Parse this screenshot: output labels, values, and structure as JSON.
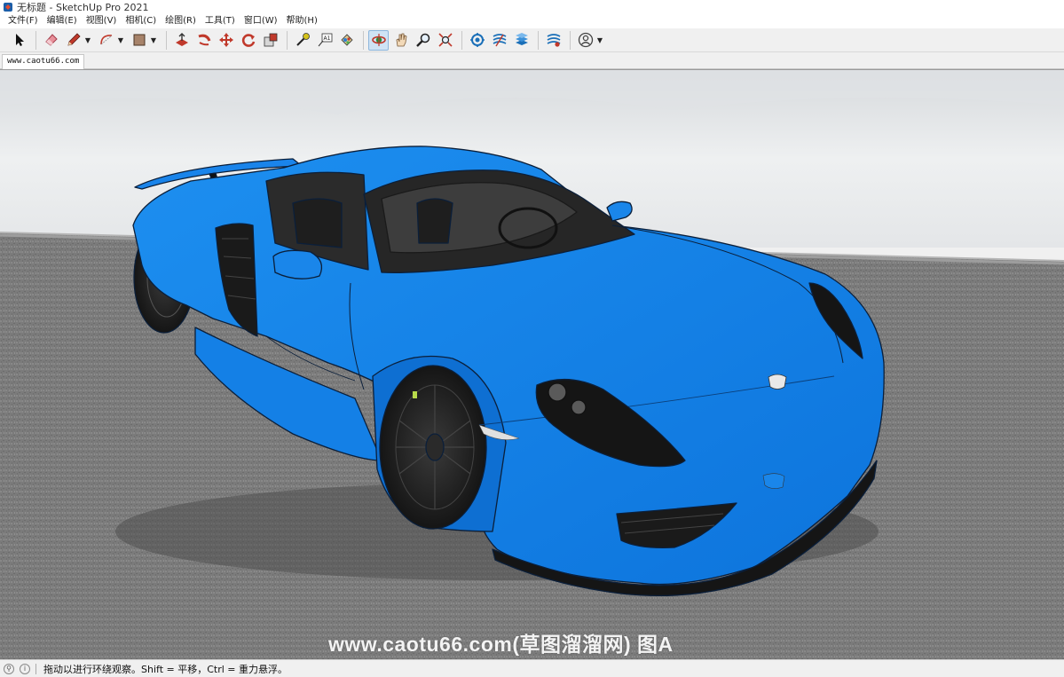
{
  "window": {
    "title": "无标题 - SketchUp Pro 2021"
  },
  "menu": [
    {
      "label": "文件(F)"
    },
    {
      "label": "编辑(E)"
    },
    {
      "label": "视图(V)"
    },
    {
      "label": "相机(C)"
    },
    {
      "label": "绘图(R)"
    },
    {
      "label": "工具(T)"
    },
    {
      "label": "窗口(W)"
    },
    {
      "label": "帮助(H)"
    }
  ],
  "toolbar": {
    "tools": [
      {
        "icon": "select-arrow-icon"
      },
      {
        "icon": "eraser-icon"
      },
      {
        "icon": "pencil-line-icon"
      },
      {
        "icon": "arc-icon"
      },
      {
        "icon": "rectangle-shape-icon"
      },
      {
        "icon": "push-pull-icon"
      },
      {
        "icon": "follow-me-icon"
      },
      {
        "icon": "move-icon"
      },
      {
        "icon": "rotate-icon"
      },
      {
        "icon": "scale-icon"
      },
      {
        "icon": "tape-measure-icon"
      },
      {
        "icon": "text-tool-icon"
      },
      {
        "icon": "paint-bucket-icon"
      },
      {
        "icon": "orbit-icon"
      },
      {
        "icon": "pan-hand-icon"
      },
      {
        "icon": "zoom-icon"
      },
      {
        "icon": "zoom-extents-icon"
      },
      {
        "icon": "warehouse-icon"
      },
      {
        "icon": "extension-warehouse-icon"
      },
      {
        "icon": "layout-send-icon"
      },
      {
        "icon": "extension-manager-icon"
      },
      {
        "icon": "account-icon"
      }
    ]
  },
  "scene_tab": {
    "label": "www.caotu66.com"
  },
  "viewport": {
    "watermark": "www.caotu66.com(草图溜溜网) 图A",
    "model_color": "#1080ec",
    "sky_color": "#e8eaec",
    "ground_color": "#7c7c7c"
  },
  "status": {
    "text": "拖动以进行环绕观察。Shift = 平移，Ctrl = 重力悬浮。"
  }
}
